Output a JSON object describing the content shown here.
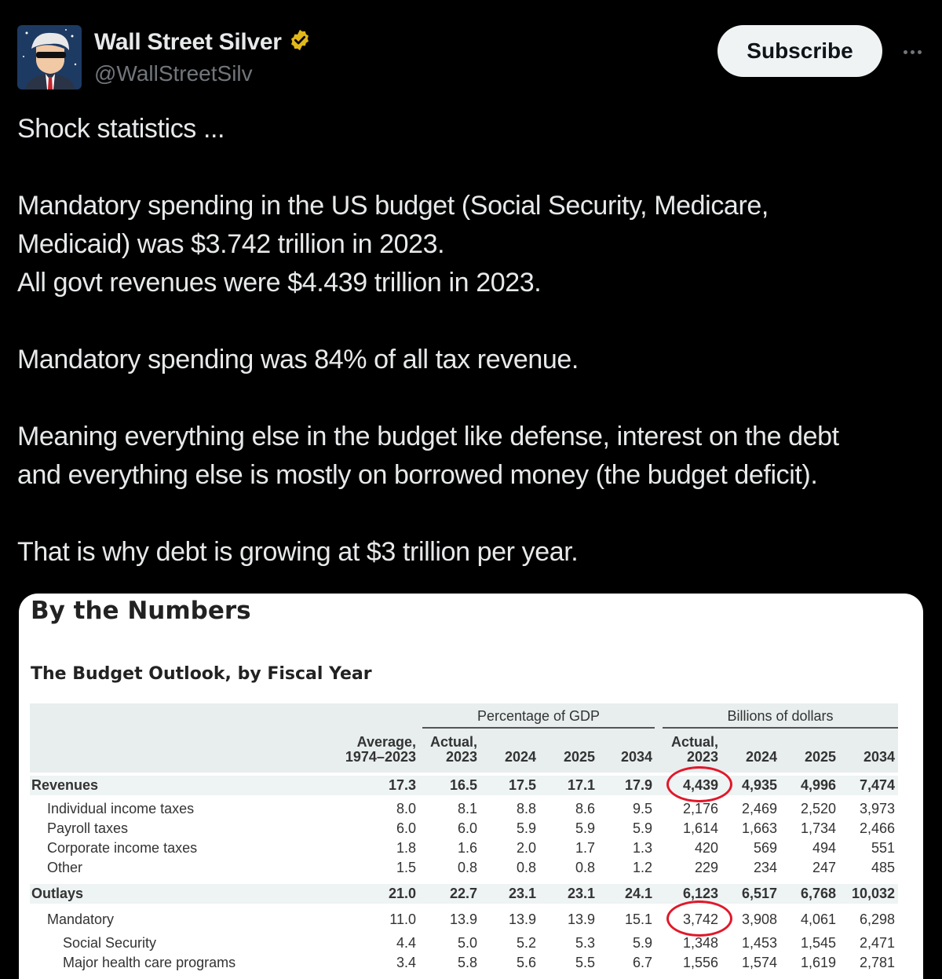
{
  "author": {
    "display_name": "Wall Street Silver",
    "handle": "@WallStreetSilv",
    "verified": "gold-verified-badge-icon"
  },
  "actions": {
    "subscribe_label": "Subscribe",
    "more_icon": "more-horizontal-icon"
  },
  "tweet": {
    "paragraphs": [
      "Shock statistics ...",
      "",
      "Mandatory spending in the US budget (Social Security, Medicare,",
      "Medicaid) was $3.742 trillion in 2023.",
      "All govt revenues were $4.439 trillion in 2023.",
      "",
      "Mandatory spending was 84% of all tax revenue.",
      "",
      "Meaning everything else in the budget like defense, interest on the debt",
      "and everything else is mostly on borrowed money (the budget deficit).",
      "",
      "That is why debt is growing at $3 trillion per year."
    ]
  },
  "image": {
    "heading": "By the Numbers",
    "table_title": "The Budget Outlook, by Fiscal Year",
    "group_pct": "Percentage of GDP",
    "group_bil": "Billions of dollars",
    "columns": [
      [
        "Average,",
        "1974–2023"
      ],
      [
        "Actual,",
        "2023"
      ],
      [
        "",
        "2024"
      ],
      [
        "",
        "2025"
      ],
      [
        "",
        "2034"
      ],
      [
        "Actual,",
        "2023"
      ],
      [
        "",
        "2024"
      ],
      [
        "",
        "2025"
      ],
      [
        "",
        "2034"
      ]
    ],
    "rows": [
      {
        "label": "Revenues",
        "indent": 0,
        "bold": true,
        "shade": true,
        "values": [
          "17.3",
          "16.5",
          "17.5",
          "17.1",
          "17.9",
          "4,439",
          "4,935",
          "4,996",
          "7,474"
        ]
      },
      {
        "label": "Individual income taxes",
        "indent": 1,
        "bold": false,
        "shade": false,
        "values": [
          "8.0",
          "8.1",
          "8.8",
          "8.6",
          "9.5",
          "2,176",
          "2,469",
          "2,520",
          "3,973"
        ]
      },
      {
        "label": "Payroll taxes",
        "indent": 1,
        "bold": false,
        "shade": false,
        "values": [
          "6.0",
          "6.0",
          "5.9",
          "5.9",
          "5.9",
          "1,614",
          "1,663",
          "1,734",
          "2,466"
        ]
      },
      {
        "label": "Corporate income taxes",
        "indent": 1,
        "bold": false,
        "shade": false,
        "values": [
          "1.8",
          "1.6",
          "2.0",
          "1.7",
          "1.3",
          "420",
          "569",
          "494",
          "551"
        ]
      },
      {
        "label": "Other",
        "indent": 1,
        "bold": false,
        "shade": false,
        "values": [
          "1.5",
          "0.8",
          "0.8",
          "0.8",
          "1.2",
          "229",
          "234",
          "247",
          "485"
        ]
      },
      {
        "label": "Outlays",
        "indent": 0,
        "bold": true,
        "shade": true,
        "values": [
          "21.0",
          "22.7",
          "23.1",
          "23.1",
          "24.1",
          "6,123",
          "6,517",
          "6,768",
          "10,032"
        ]
      },
      {
        "label": "Mandatory",
        "indent": 1,
        "bold": false,
        "shade": false,
        "values": [
          "11.0",
          "13.9",
          "13.9",
          "13.9",
          "15.1",
          "3,742",
          "3,908",
          "4,061",
          "6,298"
        ]
      },
      {
        "label": "Social Security",
        "indent": 2,
        "bold": false,
        "shade": false,
        "values": [
          "4.4",
          "5.0",
          "5.2",
          "5.3",
          "5.9",
          "1,348",
          "1,453",
          "1,545",
          "2,471"
        ]
      },
      {
        "label": "Major health care programs",
        "indent": 2,
        "bold": false,
        "shade": false,
        "values": [
          "3.4",
          "5.8",
          "5.6",
          "5.5",
          "6.7",
          "1,556",
          "1,574",
          "1,619",
          "2,781"
        ]
      }
    ],
    "circled": [
      "4,439",
      "3,742"
    ],
    "circle_color": "#e0182a"
  }
}
